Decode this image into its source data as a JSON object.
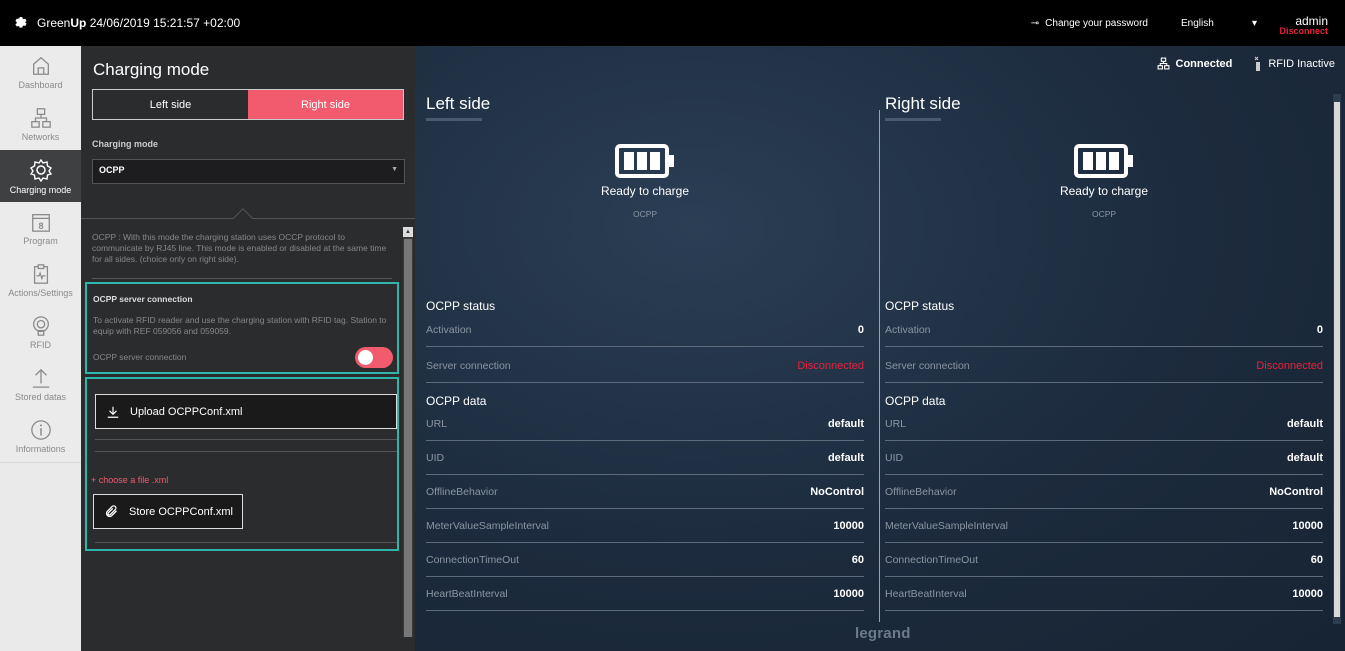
{
  "topbar": {
    "brand_prefix": "Green",
    "brand_bold": "Up",
    "datetime": "24/06/2019 15:21:57 +02:00",
    "change_password": "Change your password",
    "language": "English",
    "user": "admin",
    "disconnect": "Disconnect"
  },
  "nav": {
    "items": [
      {
        "label": "Dashboard",
        "icon": "home-icon"
      },
      {
        "label": "Networks",
        "icon": "network-icon"
      },
      {
        "label": "Charging mode",
        "icon": "gear-icon"
      },
      {
        "label": "Program",
        "icon": "calendar-icon"
      },
      {
        "label": "Actions/Settings",
        "icon": "clipboard-icon"
      },
      {
        "label": "RFID",
        "icon": "rfid-icon"
      },
      {
        "label": "Stored datas",
        "icon": "upload-icon"
      },
      {
        "label": "Informations",
        "icon": "info-icon"
      }
    ],
    "calendar_day": "8"
  },
  "panel": {
    "title": "Charging mode",
    "tab_left": "Left side",
    "tab_right": "Right side",
    "mode_label": "Charging mode",
    "mode_value": "OCPP",
    "description": "OCPP : With this mode the charging station uses OCCP protocol to communicate by RJ45 line. This mode is enabled or disabled at the same time for all sides. (choice only on right side).",
    "server_title": "OCPP server connection",
    "server_desc": "To activate RFID reader and use the charging station with RFID tag. Station to equip with REF 059056 and 059059.",
    "server_switch_label": "OCPP server connection",
    "upload_label": "Upload OCPPConf.xml",
    "choose_label": "+ choose a file .xml",
    "store_label": "Store OCPPConf.xml"
  },
  "status": {
    "connected": "Connected",
    "rfid": "RFID Inactive"
  },
  "sides": [
    {
      "title": "Left side",
      "state": "Ready to charge",
      "mode": "OCPP",
      "status_title": "OCPP status",
      "status_rows": [
        {
          "k": "Activation",
          "v": "0"
        },
        {
          "k": "Server connection",
          "v": "Disconnected"
        }
      ],
      "data_title": "OCPP data",
      "data_rows": [
        {
          "k": "URL",
          "v": "default"
        },
        {
          "k": "UID",
          "v": "default"
        },
        {
          "k": "OfflineBehavior",
          "v": "NoControl"
        },
        {
          "k": "MeterValueSampleInterval",
          "v": "10000"
        },
        {
          "k": "ConnectionTimeOut",
          "v": "60"
        },
        {
          "k": "HeartBeatInterval",
          "v": "10000"
        }
      ]
    },
    {
      "title": "Right side",
      "state": "Ready to charge",
      "mode": "OCPP",
      "status_title": "OCPP status",
      "status_rows": [
        {
          "k": "Activation",
          "v": "0"
        },
        {
          "k": "Server connection",
          "v": "Disconnected"
        }
      ],
      "data_title": "OCPP data",
      "data_rows": [
        {
          "k": "URL",
          "v": "default"
        },
        {
          "k": "UID",
          "v": "default"
        },
        {
          "k": "OfflineBehavior",
          "v": "NoControl"
        },
        {
          "k": "MeterValueSampleInterval",
          "v": "10000"
        },
        {
          "k": "ConnectionTimeOut",
          "v": "60"
        },
        {
          "k": "HeartBeatInterval",
          "v": "10000"
        }
      ]
    }
  ],
  "footer": {
    "logo": "legrand"
  },
  "colors": {
    "accent": "#f25a6e",
    "teal": "#30b5aa",
    "error": "#e8213b"
  }
}
